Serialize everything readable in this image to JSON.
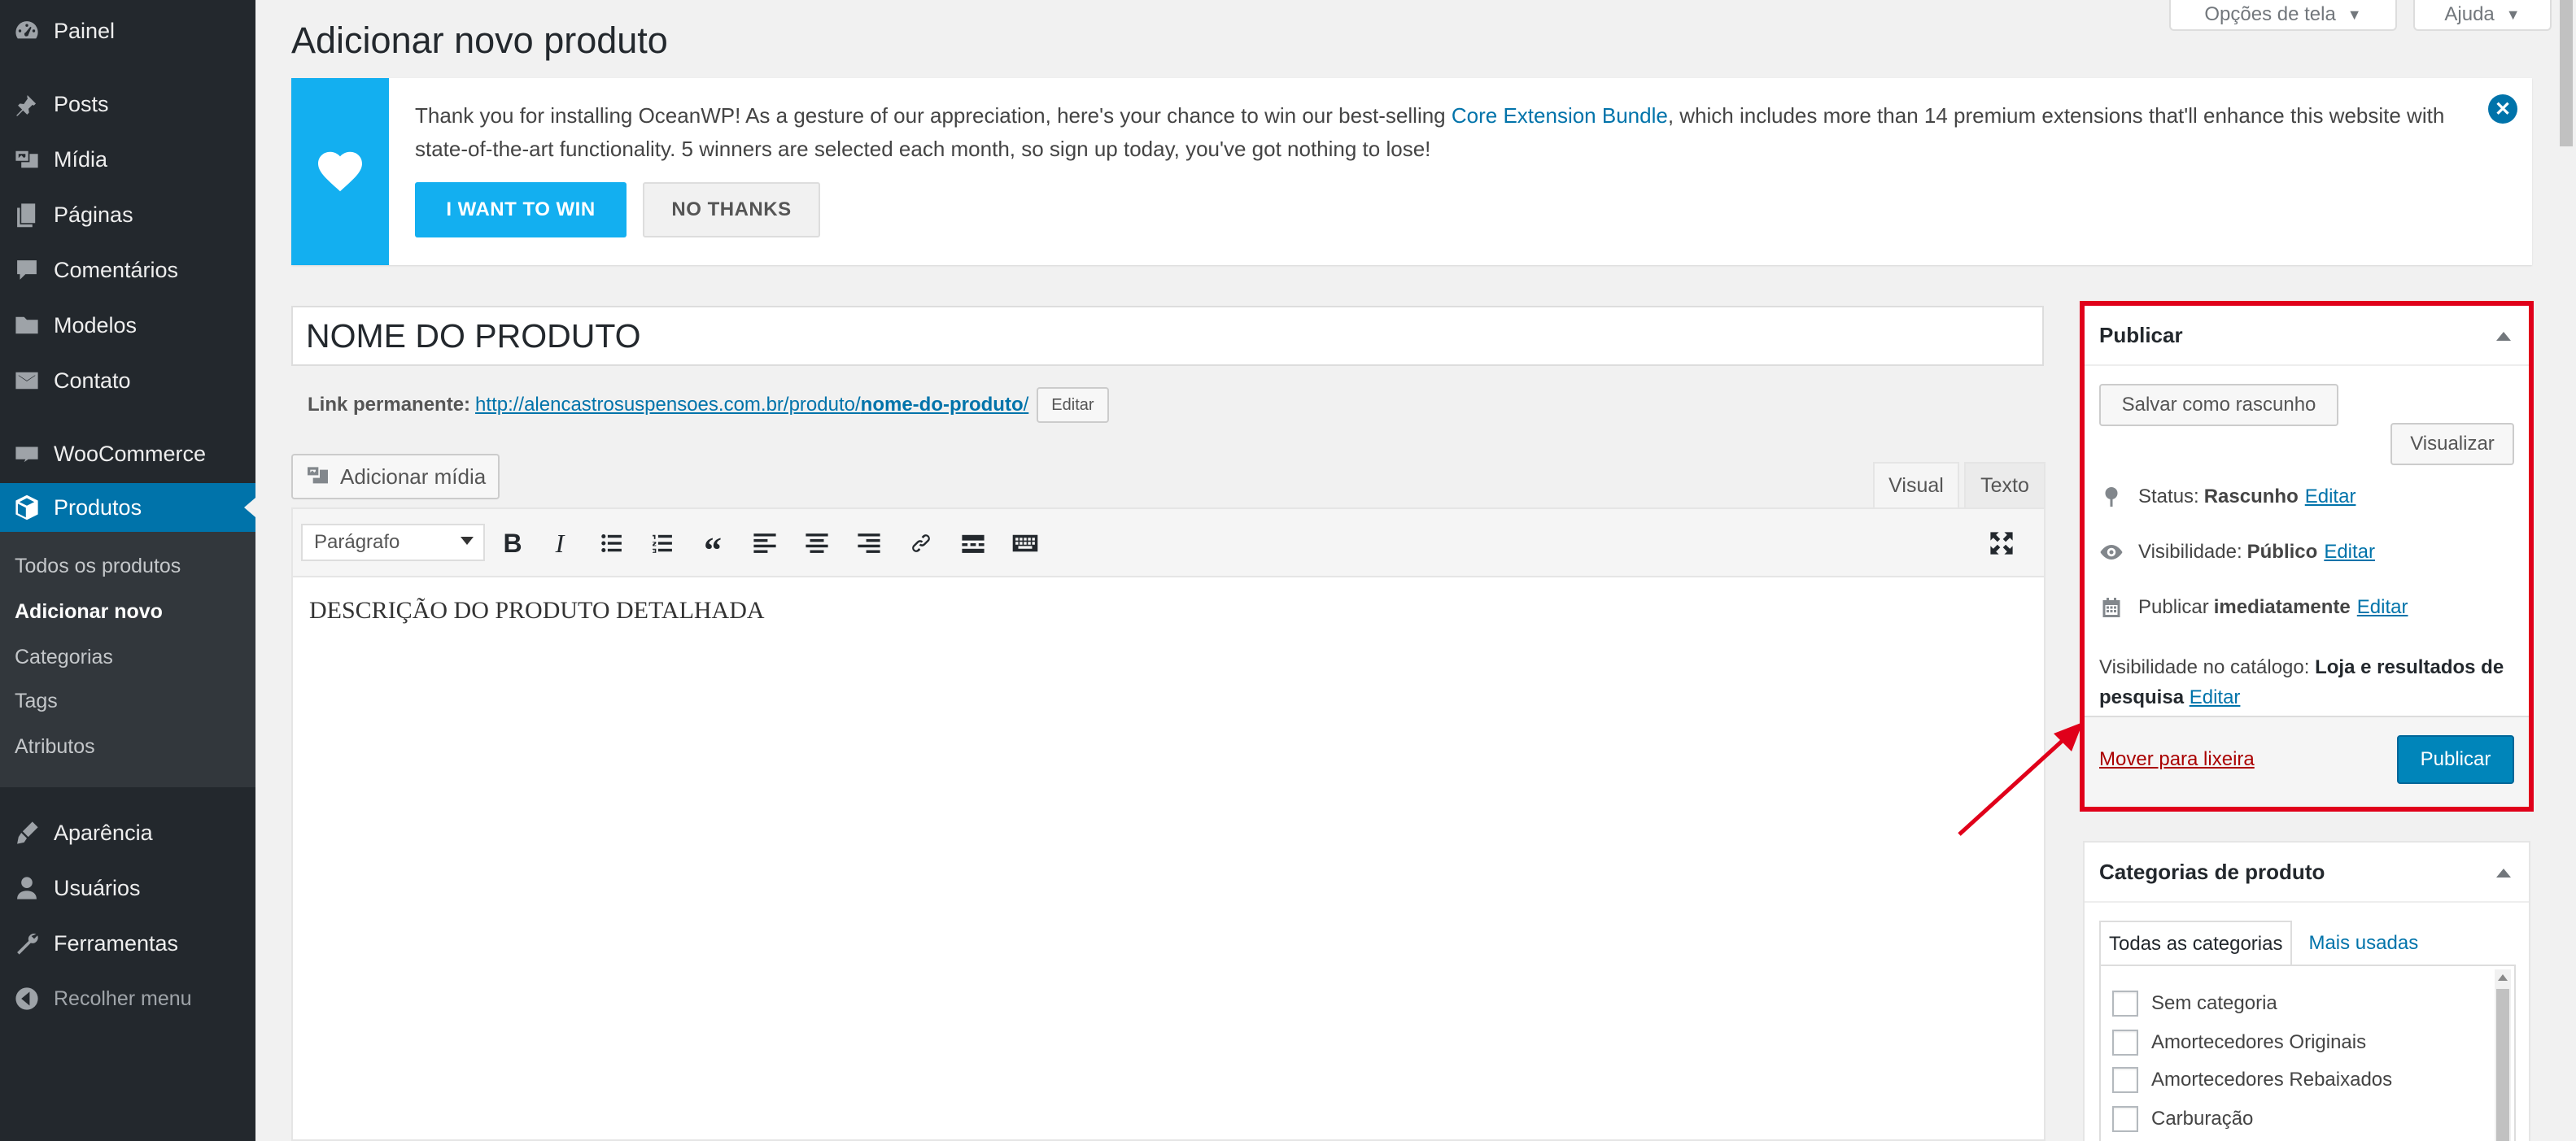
{
  "sidebar": {
    "menu": {
      "dashboard": "Painel",
      "posts": "Posts",
      "media": "Mídia",
      "pages": "Páginas",
      "comments": "Comentários",
      "templates": "Modelos",
      "contact": "Contato",
      "woocommerce": "WooCommerce",
      "products": "Produtos",
      "appearance": "Aparência",
      "users": "Usuários",
      "tools": "Ferramentas",
      "collapse": "Recolher menu"
    },
    "submenu": {
      "all_products": "Todos os produtos",
      "add_new": "Adicionar novo",
      "categories": "Categorias",
      "tags": "Tags",
      "attributes": "Atributos"
    }
  },
  "header": {
    "screen_options": "Opções de tela",
    "help": "Ajuda",
    "page_title": "Adicionar novo produto"
  },
  "notice": {
    "text_before": "Thank you for installing OceanWP! As a gesture of our appreciation, here's your chance to win our best-selling ",
    "link": "Core Extension Bundle",
    "text_after": ", which includes more than 14 premium extensions that'll enhance this website with state-of-the-art functionality. 5 winners are selected each month, so sign up today, you've got nothing to lose!",
    "win_button": "I WANT TO WIN",
    "no_thanks_button": "NO THANKS",
    "close": "✕"
  },
  "editor": {
    "title_value": "NOME DO PRODUTO",
    "permalink_label": "Link permanente:",
    "permalink_base": "http://alencastrosuspensoes.com.br/produto/",
    "permalink_slug": "nome-do-produto",
    "permalink_trailing": "/",
    "permalink_edit": "Editar",
    "add_media": "Adicionar mídia",
    "tab_visual": "Visual",
    "tab_text": "Texto",
    "format_select": "Parágrafo",
    "content": "DESCRIÇÃO DO PRODUTO DETALHADA"
  },
  "publish": {
    "title": "Publicar",
    "save_draft": "Salvar como rascunho",
    "preview": "Visualizar",
    "status_label": "Status:",
    "status_value": "Rascunho",
    "visibility_label": "Visibilidade:",
    "visibility_value": "Público",
    "publish_label": "Publicar",
    "publish_value": "imediatamente",
    "edit": "Editar",
    "catalog_label": "Visibilidade no catálogo:",
    "catalog_value": "Loja e resultados de pesquisa",
    "trash": "Mover para lixeira",
    "publish_button": "Publicar"
  },
  "categories": {
    "title": "Categorias de produto",
    "tab_all": "Todas as categorias",
    "tab_popular": "Mais usadas",
    "items": [
      "Sem categoria",
      "Amortecedores Originais",
      "Amortecedores Rebaixados",
      "Carburação"
    ]
  },
  "colors": {
    "sidebar_bg": "#23282d",
    "accent": "#0073aa",
    "notice_accent": "#13aff0",
    "highlight_frame": "#e0001a",
    "annotation_arrow": "#e0001a"
  }
}
